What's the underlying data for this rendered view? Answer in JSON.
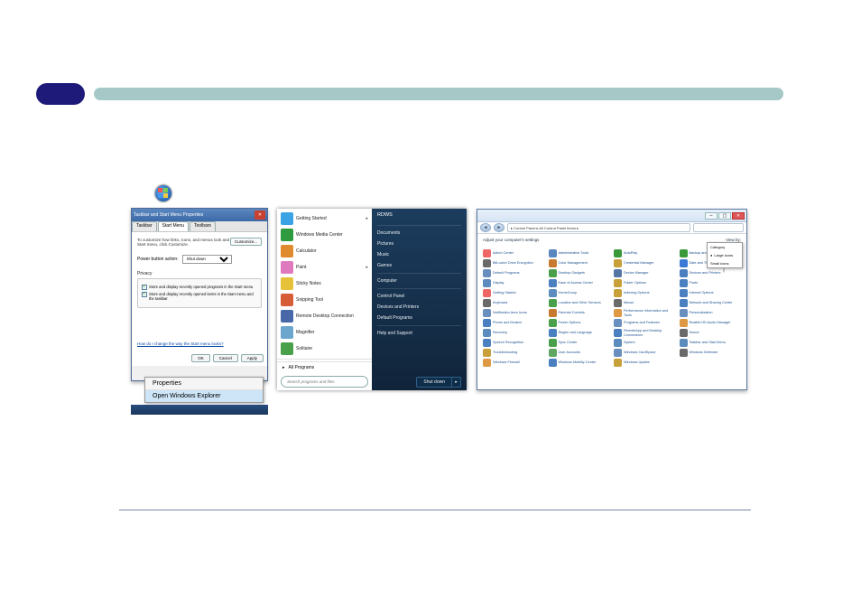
{
  "pill": {},
  "context_menu": {
    "items": [
      "Properties",
      "Open Windows Explorer"
    ],
    "highlighted": 1
  },
  "dlg1": {
    "title": "Taskbar and Start Menu Properties",
    "tabs": [
      "Taskbar",
      "Start Menu",
      "Toolbars"
    ],
    "active_tab": 1,
    "desc": "To customize how links, icons, and menus look and behave in the Start menu, click Customize.",
    "customize": "Customize...",
    "pba_label": "Power button action:",
    "pba_value": "Shut down",
    "privacy_label": "Privacy",
    "chk1": "Store and display recently opened programs in the Start menu",
    "chk2": "Store and display recently opened items in the Start menu and the taskbar",
    "link": "How do I change the way the Start menu looks?",
    "btn_ok": "OK",
    "btn_cancel": "Cancel",
    "btn_apply": "Apply"
  },
  "start_menu": {
    "programs": [
      {
        "label": "Getting Started",
        "chev": true,
        "bg": "#3aa3e6"
      },
      {
        "label": "Windows Media Center",
        "bg": "#2f9b3f"
      },
      {
        "label": "Calculator",
        "bg": "#e08a2f"
      },
      {
        "label": "Paint",
        "chev": true,
        "bg": "#e07abf"
      },
      {
        "label": "Sticky Notes",
        "bg": "#e6c23a"
      },
      {
        "label": "Snipping Tool",
        "bg": "#d75c38"
      },
      {
        "label": "Remote Desktop Connection",
        "bg": "#4868a8"
      },
      {
        "label": "Magnifier",
        "bg": "#6da6cc"
      },
      {
        "label": "Solitaire",
        "bg": "#4a9f4a"
      }
    ],
    "all_programs": "All Programs",
    "search_placeholder": "Search programs and files",
    "right_top": "RDWS",
    "right_items": [
      "Documents",
      "Pictures",
      "Music",
      "Games",
      "Computer",
      "Control Panel",
      "Devices and Printers",
      "Default Programs",
      "Help and Support"
    ],
    "shutdown": "Shut down"
  },
  "control_panel": {
    "path": "▸ Control Panel ▸ All Control Panel Items ▸",
    "heading": "Adjust your computer's settings",
    "view_by": "View by:",
    "view_options": [
      "Category",
      "Large icons",
      "Small icons"
    ],
    "view_selected": 1,
    "items": [
      {
        "l": "Action Center",
        "c": "#e66"
      },
      {
        "l": "Administrative Tools",
        "c": "#5a87c0"
      },
      {
        "l": "AutoPlay",
        "c": "#3a9a3a"
      },
      {
        "l": "Backup and Restore",
        "c": "#3a9a3a"
      },
      {
        "l": "BitLocker Drive Encryption",
        "c": "#6a6a6a"
      },
      {
        "l": "Color Management",
        "c": "#c77a2f"
      },
      {
        "l": "Credential Manager",
        "c": "#c7a03a"
      },
      {
        "l": "Date and Time",
        "c": "#3a7ad6"
      },
      {
        "l": "Default Programs",
        "c": "#6a8fbf"
      },
      {
        "l": "Desktop Gadgets",
        "c": "#4a9f4a"
      },
      {
        "l": "Device Manager",
        "c": "#5575a5"
      },
      {
        "l": "Devices and Printers",
        "c": "#4a7fc0"
      },
      {
        "l": "Display",
        "c": "#5c8cbd"
      },
      {
        "l": "Ease of Access Center",
        "c": "#4a7fc0"
      },
      {
        "l": "Folder Options",
        "c": "#c7a03a"
      },
      {
        "l": "Fonts",
        "c": "#4a7fc0"
      },
      {
        "l": "Getting Started",
        "c": "#e66"
      },
      {
        "l": "HomeGroup",
        "c": "#5c8cbd"
      },
      {
        "l": "Indexing Options",
        "c": "#c7a03a"
      },
      {
        "l": "Internet Options",
        "c": "#4a7fc0"
      },
      {
        "l": "Keyboard",
        "c": "#6a6a6a"
      },
      {
        "l": "Location and Other Sensors",
        "c": "#4a9f4a"
      },
      {
        "l": "Mouse",
        "c": "#6a6a6a"
      },
      {
        "l": "Network and Sharing Center",
        "c": "#4a7fc0"
      },
      {
        "l": "Notification Area Icons",
        "c": "#6a8fbf"
      },
      {
        "l": "Parental Controls",
        "c": "#c77a2f"
      },
      {
        "l": "Performance Information and Tools",
        "c": "#d94"
      },
      {
        "l": "Personalization",
        "c": "#6a8fbf"
      },
      {
        "l": "Phone and Modem",
        "c": "#4a7fc0"
      },
      {
        "l": "Power Options",
        "c": "#4a9f4a"
      },
      {
        "l": "Programs and Features",
        "c": "#6a8fbf"
      },
      {
        "l": "Realtek HD Audio Manager",
        "c": "#d94"
      },
      {
        "l": "Recovery",
        "c": "#5c8cbd"
      },
      {
        "l": "Region and Language",
        "c": "#4a7fc0"
      },
      {
        "l": "RemoteApp and Desktop Connections",
        "c": "#4a7fc0"
      },
      {
        "l": "Sound",
        "c": "#6a6a6a"
      },
      {
        "l": "Speech Recognition",
        "c": "#4a7fc0"
      },
      {
        "l": "Sync Center",
        "c": "#4a9f4a"
      },
      {
        "l": "System",
        "c": "#5c8cbd"
      },
      {
        "l": "Taskbar and Start Menu",
        "c": "#5c8cbd"
      },
      {
        "l": "Troubleshooting",
        "c": "#c7a03a"
      },
      {
        "l": "User Accounts",
        "c": "#5fa760"
      },
      {
        "l": "Windows CardSpace",
        "c": "#6a8fbf"
      },
      {
        "l": "Windows Defender",
        "c": "#6a6a6a"
      },
      {
        "l": "Windows Firewall",
        "c": "#d94"
      },
      {
        "l": "Windows Mobility Center",
        "c": "#4a7fc0"
      },
      {
        "l": "Windows Update",
        "c": "#c7a03a"
      }
    ]
  }
}
